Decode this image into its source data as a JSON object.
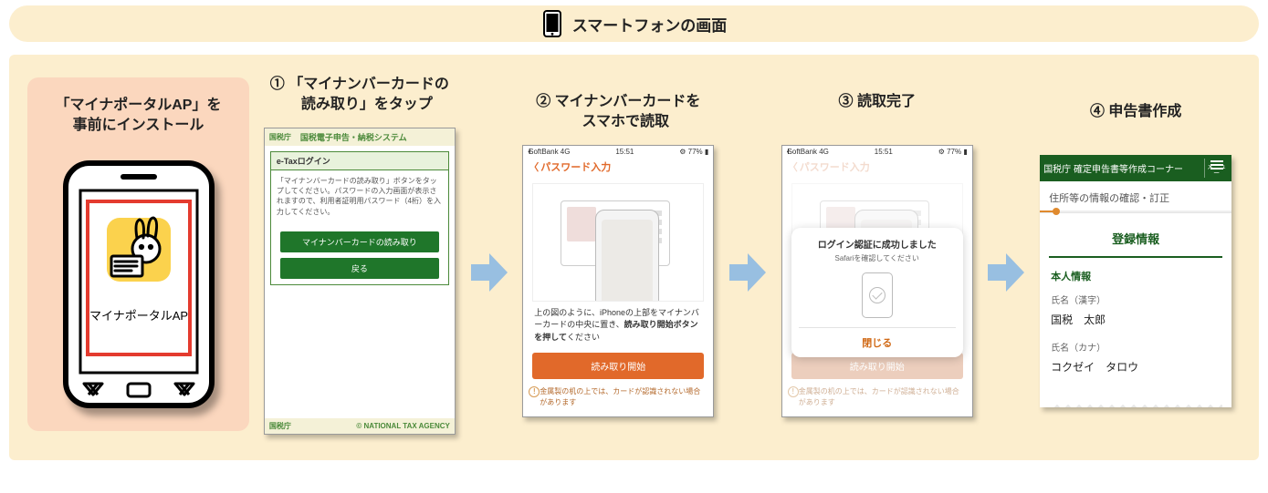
{
  "banner": {
    "title": "スマートフォンの画面"
  },
  "step0": {
    "title": "「マイナポータルAP」を\n事前にインストール",
    "app_label": "マイナポータルAP"
  },
  "step1": {
    "title": "①  「マイナンバーカードの\n　読み取り」をタップ",
    "header_agency": "国税庁",
    "header_system": "国税電子申告・納税システム",
    "card_head": "e-Taxログイン",
    "card_body": "「マイナンバーカードの読み取り」ボタンをタップしてください。パスワードの入力画面が表示されますので、利用者証明用パスワード（4桁）を入力してください。",
    "btn_read": "マイナンバーカードの読み取り",
    "btn_back": "戻る",
    "footer_agency": "国税庁",
    "footer_copy": "© NATIONAL TAX AGENCY"
  },
  "ios_status": {
    "carrier": "SoftBank 4G",
    "time": "15:51",
    "battery": "77%"
  },
  "step2": {
    "title": "② マイナンバーカードを\n　スマホで読取",
    "nav_back": "パスワード入力",
    "instruction_a": "上の図のように、iPhoneの上部をマイナンバーカードの中央に置き、",
    "instruction_b": "読み取り開始ボタンを押して",
    "instruction_c": "ください",
    "btn": "読み取り開始",
    "note": "金属製の机の上では、カードが認識されない場合があります"
  },
  "step3": {
    "title": "③ 読取完了",
    "nav_back": "パスワード入力",
    "modal_title": "ログイン認証に成功しました",
    "modal_sub": "Safariを確認してください",
    "modal_close": "閉じる",
    "btn": "読み取り開始",
    "note": "金属製の机の上では、カードが認識されない場合があります"
  },
  "step4": {
    "title": "④ 申告書作成",
    "header_left": "国税庁 確定申告書等作成コーナー",
    "menu_label": "メニュー",
    "sub": "住所等の情報の確認・訂正",
    "section": "登録情報",
    "category": "本人情報",
    "field1_label": "氏名（漢字）",
    "field1_value": "国税　太郎",
    "field2_label": "氏名（カナ）",
    "field2_value": "コクゼイ　タロウ"
  }
}
